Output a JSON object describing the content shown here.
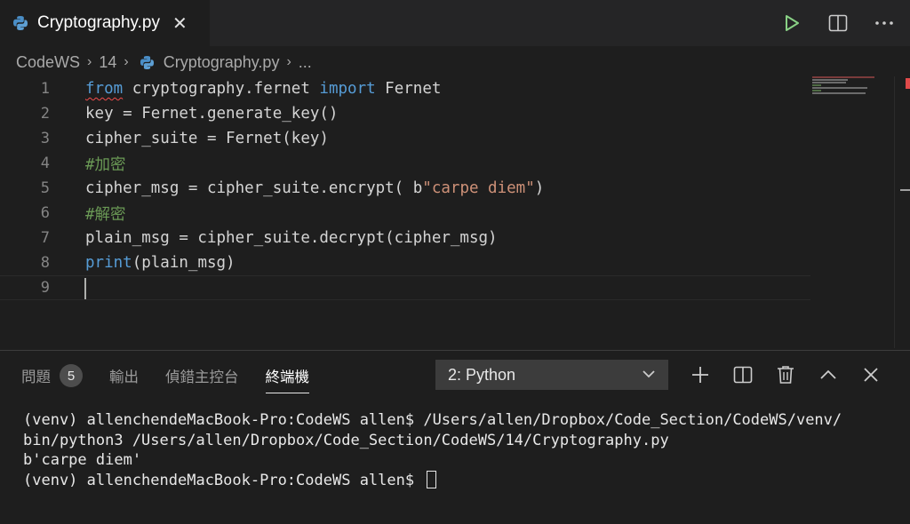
{
  "tab": {
    "filename": "Cryptography.py"
  },
  "breadcrumb": {
    "items": [
      "CodeWS",
      "14",
      "Cryptography.py",
      "..."
    ]
  },
  "editor": {
    "lines": [
      {
        "number": "1",
        "tokens": [
          {
            "t": "from",
            "c": "kw",
            "squiggle": true
          },
          {
            "t": " cryptography.fernet ",
            "c": ""
          },
          {
            "t": "import",
            "c": "kw"
          },
          {
            "t": " Fernet",
            "c": ""
          }
        ]
      },
      {
        "number": "2",
        "tokens": [
          {
            "t": "key = Fernet.generate_key()",
            "c": ""
          }
        ]
      },
      {
        "number": "3",
        "tokens": [
          {
            "t": "cipher_suite = Fernet(key)",
            "c": ""
          }
        ]
      },
      {
        "number": "4",
        "tokens": [
          {
            "t": "#加密",
            "c": "cm"
          }
        ]
      },
      {
        "number": "5",
        "tokens": [
          {
            "t": "cipher_msg = cipher_suite.encrypt( b",
            "c": ""
          },
          {
            "t": "\"carpe diem\"",
            "c": "str"
          },
          {
            "t": ")",
            "c": ""
          }
        ]
      },
      {
        "number": "6",
        "tokens": [
          {
            "t": "#解密",
            "c": "cm"
          }
        ]
      },
      {
        "number": "7",
        "tokens": [
          {
            "t": "plain_msg = cipher_suite.decrypt(cipher_msg)",
            "c": ""
          }
        ]
      },
      {
        "number": "8",
        "tokens": [
          {
            "t": "print",
            "c": "kw"
          },
          {
            "t": "(plain_msg)",
            "c": ""
          }
        ]
      },
      {
        "number": "9",
        "tokens": []
      }
    ]
  },
  "panel": {
    "tabs": [
      {
        "label": "問題",
        "badge": "5"
      },
      {
        "label": "輸出"
      },
      {
        "label": "偵錯主控台"
      },
      {
        "label": "終端機",
        "active": true
      }
    ],
    "terminal_select": "2: Python",
    "terminal_lines": [
      "(venv) allenchendeMacBook-Pro:CodeWS allen$ /Users/allen/Dropbox/Code_Section/CodeWS/venv/",
      "bin/python3 /Users/allen/Dropbox/Code_Section/CodeWS/14/Cryptography.py",
      "b'carpe diem'",
      "(venv) allenchendeMacBook-Pro:CodeWS allen$ "
    ]
  },
  "colors": {
    "keyword": "#569cd6",
    "comment": "#6a9955",
    "string": "#ce9178",
    "run": "#89d185"
  },
  "icons": [
    "python-icon",
    "close-icon",
    "run-icon",
    "split-editor-icon",
    "more-icon",
    "chevron-down-icon",
    "plus-icon",
    "split-terminal-icon",
    "trash-icon",
    "chevron-up-icon",
    "close-panel-icon"
  ]
}
